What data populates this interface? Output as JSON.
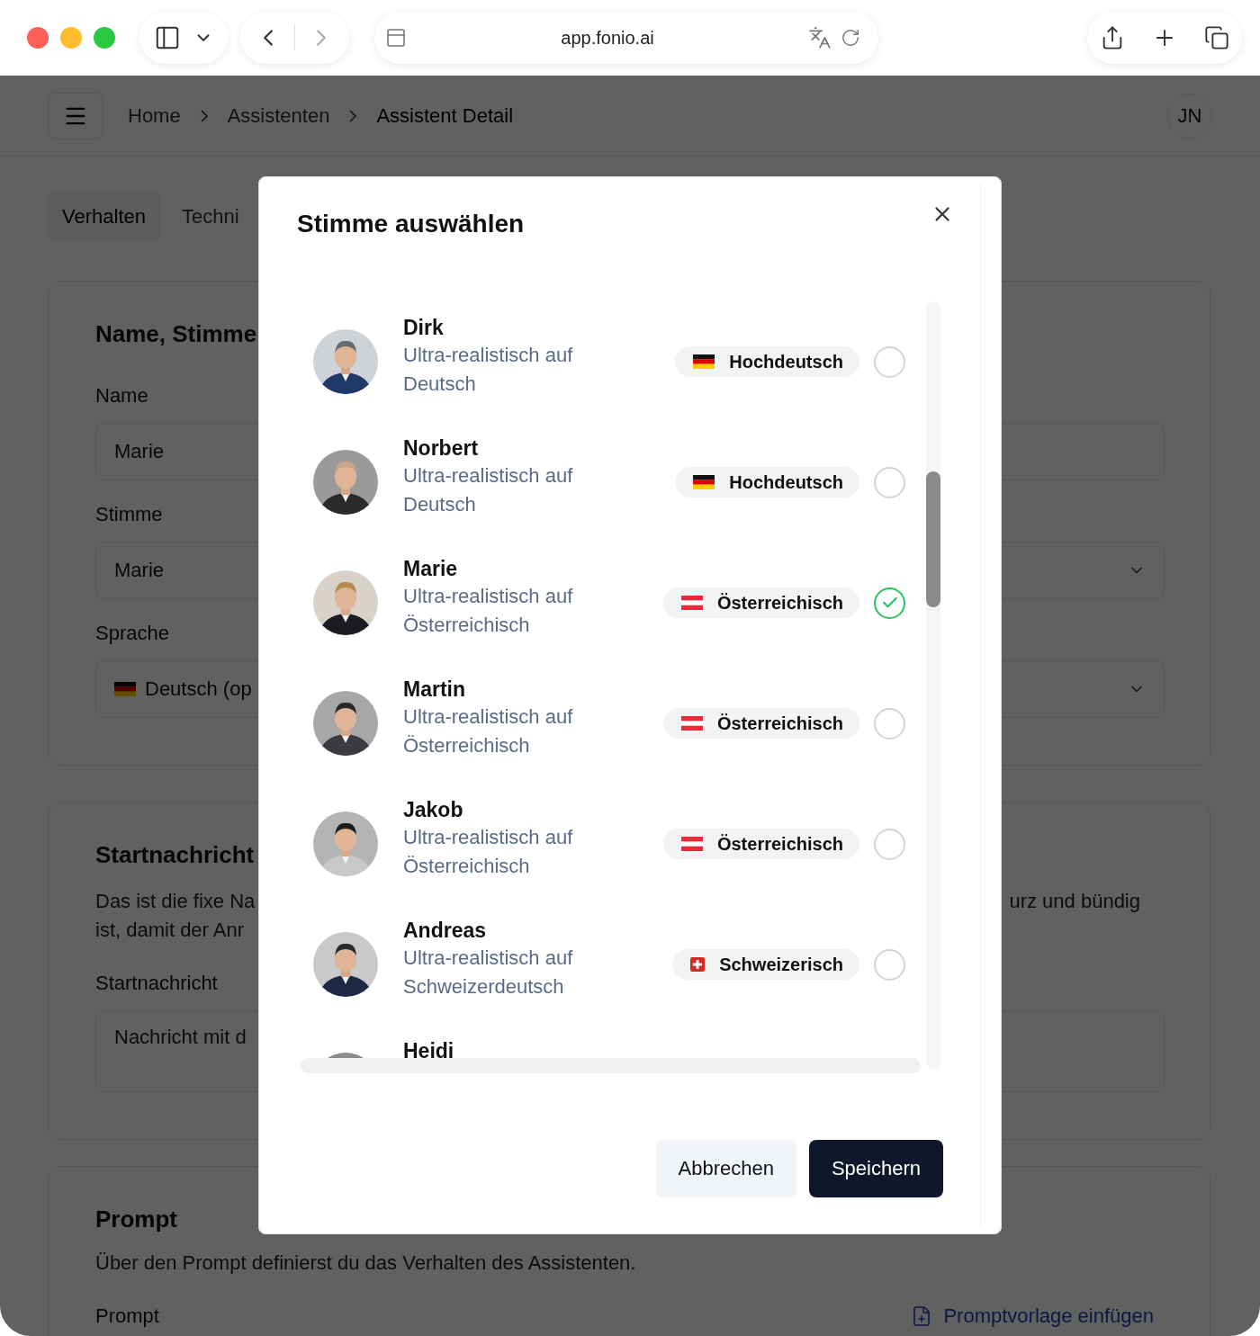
{
  "browser": {
    "url": "app.fonio.ai"
  },
  "header": {
    "breadcrumbs": [
      {
        "label": "Home",
        "current": false
      },
      {
        "label": "Assistenten",
        "current": false
      },
      {
        "label": "Assistent Detail",
        "current": true
      }
    ],
    "user_initials": "JN"
  },
  "tabs": [
    {
      "label": "Verhalten",
      "selected": true
    },
    {
      "label": "Techni",
      "selected": false
    }
  ],
  "section_name": {
    "title": "Name, Stimme",
    "fields": [
      {
        "label": "Name",
        "kind": "input",
        "value": "Marie"
      },
      {
        "label": "Stimme",
        "kind": "select",
        "value": "Marie"
      },
      {
        "label": "Sprache",
        "kind": "select",
        "value": "Deutsch (op",
        "flag": {
          "kind": "de"
        }
      }
    ]
  },
  "section_start": {
    "title": "Startnachricht",
    "description_left": [
      "Das ist die fixe Na",
      "ist, damit der Anr"
    ],
    "description_right": "urz und bündig",
    "field": {
      "label": "Startnachricht",
      "placeholder": "Nachricht mit d"
    }
  },
  "section_prompt": {
    "title": "Prompt",
    "description": "Über den Prompt definierst du das Verhalten des Assistenten.",
    "field_label": "Prompt",
    "link": "Promptvorlage einfügen"
  },
  "dialog": {
    "title": "Stimme auswählen",
    "voices": [
      {
        "name": "Dirk",
        "description": "Ultra-realistisch auf Deutsch",
        "language": "Hochdeutsch",
        "flag": {
          "kind": "de"
        },
        "selected": false
      },
      {
        "name": "Norbert",
        "description": "Ultra-realistisch auf Deutsch",
        "language": "Hochdeutsch",
        "flag": {
          "kind": "de"
        },
        "selected": false
      },
      {
        "name": "Marie",
        "description": "Ultra-realistisch auf Österreichisch",
        "language": "Österreichisch",
        "flag": {
          "kind": "at"
        },
        "selected": true
      },
      {
        "name": "Martin",
        "description": "Ultra-realistisch auf Österreichisch",
        "language": "Österreichisch",
        "flag": {
          "kind": "at"
        },
        "selected": false
      },
      {
        "name": "Jakob",
        "description": "Ultra-realistisch auf Österreichisch",
        "language": "Österreichisch",
        "flag": {
          "kind": "at"
        },
        "selected": false
      },
      {
        "name": "Andreas",
        "description": "Ultra-realistisch auf Schweizerdeutsch",
        "language": "Schweizerisch",
        "flag": {
          "kind": "ch"
        },
        "selected": false
      },
      {
        "name": "Heidi"
      }
    ],
    "cancel": "Abbrechen",
    "save": "Speichern"
  }
}
